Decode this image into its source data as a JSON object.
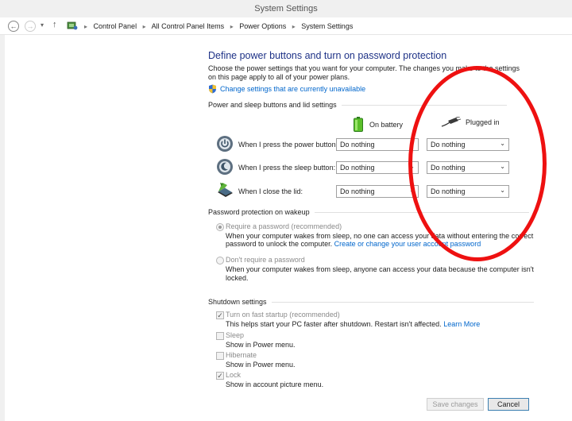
{
  "window": {
    "title": "System Settings"
  },
  "nav": {
    "back_icon": "back-arrow-icon",
    "forward_icon": "forward-arrow-icon",
    "breadcrumb": [
      "Control Panel",
      "All Control Panel Items",
      "Power Options",
      "System Settings"
    ]
  },
  "main": {
    "heading": "Define power buttons and turn on password protection",
    "description": "Choose the power settings that you want for your computer. The changes you make to the settings on this page apply to all of your power plans.",
    "change_link": "Change settings that are currently unavailable"
  },
  "power_section": {
    "title": "Power and sleep buttons and lid settings",
    "col_battery": "On battery",
    "col_plugged": "Plugged in",
    "rows": [
      {
        "label": "When I press the power button:",
        "battery": "Do nothing",
        "plugged": "Do nothing"
      },
      {
        "label": "When I press the sleep button:",
        "battery": "Do nothing",
        "plugged": "Do nothing"
      },
      {
        "label": "When I close the lid:",
        "battery": "Do nothing",
        "plugged": "Do nothing"
      }
    ]
  },
  "password_section": {
    "title": "Password protection on wakeup",
    "require_label": "Require a password (recommended)",
    "require_desc_1": "When your computer wakes from sleep, no one can access your data without entering the correct",
    "require_desc_2": "password to unlock the computer.",
    "require_link": "Create or change your user account password",
    "dont_label": "Don't require a password",
    "dont_desc_1": "When your computer wakes from sleep, anyone can access your data because the computer isn't",
    "dont_desc_2": "locked.",
    "selected": "require"
  },
  "shutdown_section": {
    "title": "Shutdown settings",
    "items": [
      {
        "label": "Turn on fast startup (recommended)",
        "desc": "This helps start your PC faster after shutdown. Restart isn't affected.",
        "link": "Learn More",
        "checked": true
      },
      {
        "label": "Sleep",
        "desc": "Show in Power menu.",
        "checked": false
      },
      {
        "label": "Hibernate",
        "desc": "Show in Power menu.",
        "checked": false
      },
      {
        "label": "Lock",
        "desc": "Show in account picture menu.",
        "checked": true
      }
    ]
  },
  "footer": {
    "save_label": "Save changes",
    "cancel_label": "Cancel"
  },
  "annotation": {
    "color": "#ee1111"
  }
}
